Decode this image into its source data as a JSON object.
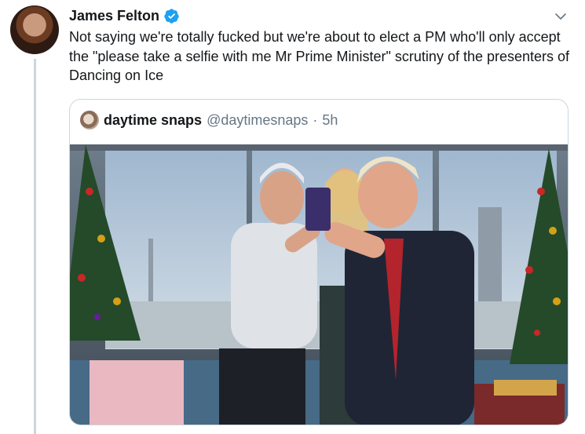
{
  "tweet": {
    "author_name": "James Felton",
    "text": "Not saying we're totally fucked but we're about to elect a PM who'll only accept the \"please take a selfie with me Mr Prime Minister\" scrutiny of the presenters of Dancing on Ice"
  },
  "quote": {
    "name": "daytime snaps",
    "handle": "@daytimesnaps",
    "separator": "·",
    "time": "5h"
  },
  "icons": {
    "verified": "verified-badge-icon",
    "menu": "chevron-down-icon"
  },
  "colors": {
    "text_primary": "#14171a",
    "text_secondary": "#657786",
    "verified_blue": "#1da1f2",
    "border": "#ccd6dd"
  }
}
